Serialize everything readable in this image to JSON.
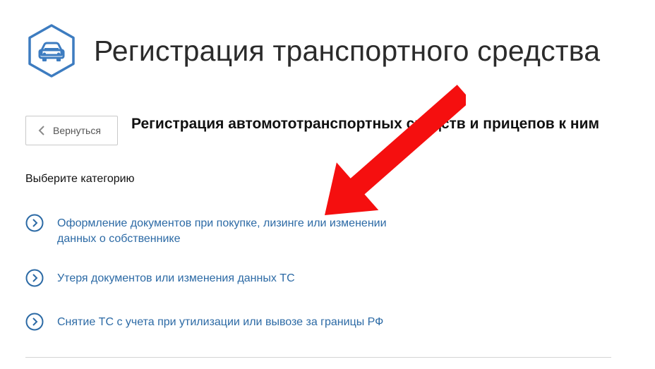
{
  "header": {
    "icon": "car-icon",
    "title": "Регистрация транспортного средства"
  },
  "back_button": {
    "icon": "chevron-left-icon",
    "label": "Вернуться"
  },
  "section": {
    "title": "Регистрация автомототранспортных средств и прицепов к ним"
  },
  "category": {
    "label": "Выберите категорию",
    "options": [
      {
        "icon": "chevron-right-circle-icon",
        "label": "Оформление документов при покупке, лизинге или изменении данных о собственнике"
      },
      {
        "icon": "chevron-right-circle-icon",
        "label": "Утеря документов или изменения данных ТС"
      },
      {
        "icon": "chevron-right-circle-icon",
        "label": "Снятие ТС с учета при утилизации или вывозе за границы РФ"
      }
    ]
  },
  "annotation": {
    "icon": "red-arrow-icon",
    "color": "#f50f0f"
  },
  "colors": {
    "accent": "#3d7cc0",
    "link": "#2c6aa5",
    "text": "#111111"
  }
}
